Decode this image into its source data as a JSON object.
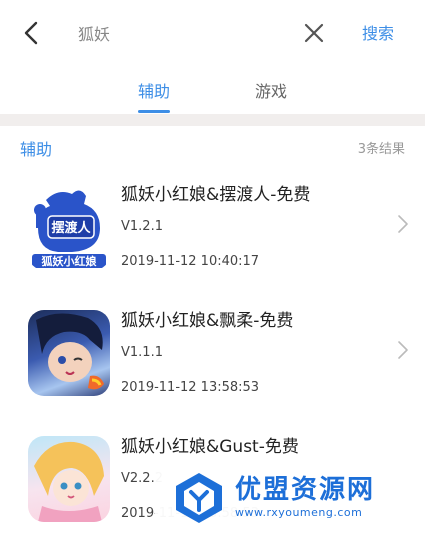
{
  "search": {
    "query": "狐妖",
    "search_label": "搜索"
  },
  "tabs": [
    {
      "label": "辅助",
      "active": true
    },
    {
      "label": "游戏",
      "active": false
    }
  ],
  "section": {
    "title": "辅助",
    "count": "3条结果"
  },
  "items": [
    {
      "title": "狐妖小红娘&摆渡人-免费",
      "version": "V1.2.1",
      "date": "2019-11-12 10:40:17",
      "icon_text": "摆渡人",
      "icon_banner": "狐妖小红娘"
    },
    {
      "title": "狐妖小红娘&飘柔-免费",
      "version": "V1.1.1",
      "date": "2019-11-12 13:58:53"
    },
    {
      "title": "狐妖小红娘&Gust-免费",
      "version": "V2.2.2",
      "date": "2019-11-12 13:58:53"
    }
  ],
  "watermark": {
    "name": "优盟资源网",
    "url": "www.rxyoumeng.com"
  },
  "colors": {
    "accent": "#3d8ee6",
    "divider": "#f1eeed",
    "watermark": "#1d6fd8"
  },
  "icons": [
    "back-arrow-icon",
    "clear-icon",
    "chevron-right-icon"
  ]
}
